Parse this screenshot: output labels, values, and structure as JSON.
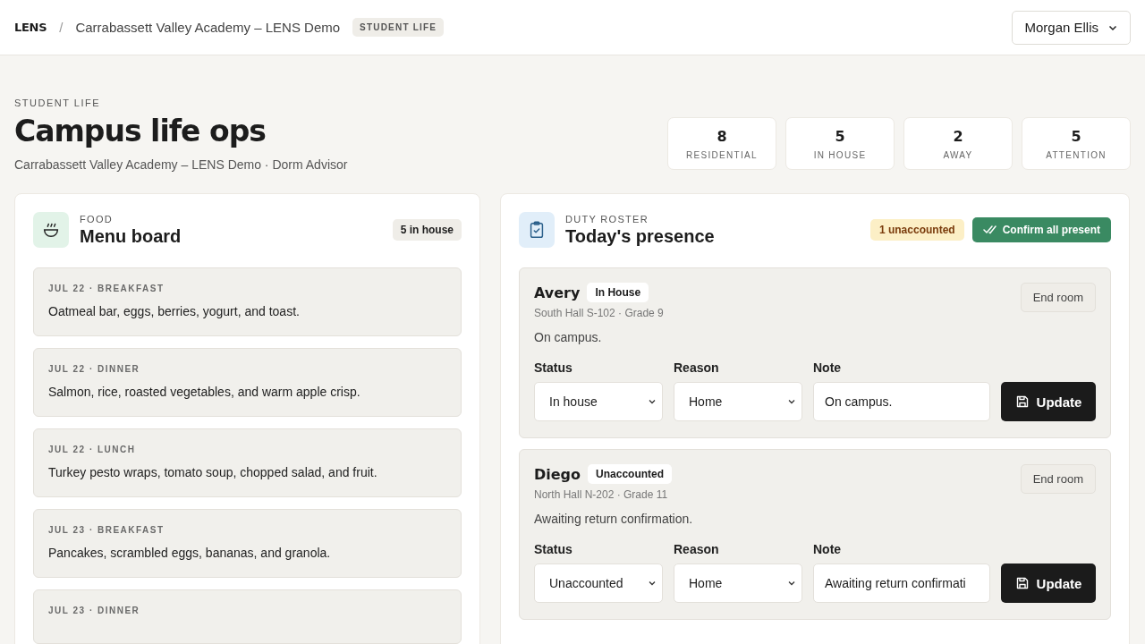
{
  "topbar": {
    "logo": "LENS",
    "separator": "/",
    "school": "Carrabassett Valley Academy – LENS Demo",
    "tag": "STUDENT LIFE",
    "user": "Morgan Ellis"
  },
  "page": {
    "eyebrow": "STUDENT LIFE",
    "title": "Campus life ops",
    "subtitle": "Carrabassett Valley Academy – LENS Demo · Dorm Advisor"
  },
  "stats": [
    {
      "value": "8",
      "label": "RESIDENTIAL"
    },
    {
      "value": "5",
      "label": "IN HOUSE"
    },
    {
      "value": "2",
      "label": "AWAY"
    },
    {
      "value": "5",
      "label": "ATTENTION"
    }
  ],
  "menu_board": {
    "eyebrow": "FOOD",
    "title": "Menu board",
    "badge": "5 in house",
    "items": [
      {
        "label": "JUL 22 · BREAKFAST",
        "text": "Oatmeal bar, eggs, berries, yogurt, and toast."
      },
      {
        "label": "JUL 22 · DINNER",
        "text": "Salmon, rice, roasted vegetables, and warm apple crisp."
      },
      {
        "label": "JUL 22 · LUNCH",
        "text": "Turkey pesto wraps, tomato soup, chopped salad, and fruit."
      },
      {
        "label": "JUL 23 · BREAKFAST",
        "text": "Pancakes, scrambled eggs, bananas, and granola."
      },
      {
        "label": "JUL 23 · DINNER"
      }
    ]
  },
  "roster": {
    "eyebrow": "DUTY ROSTER",
    "title": "Today's presence",
    "badge": "1 unaccounted",
    "confirm_button": "Confirm all present",
    "students": [
      {
        "name": "Avery",
        "status_badge": "In House",
        "room": "South Hall S-102 · Grade 9",
        "note_text": "On campus.",
        "end_button": "End room",
        "status_label": "Status",
        "status": "In house",
        "reason_label": "Reason",
        "reason": "Home",
        "note_label": "Note",
        "note": "On campus.",
        "update_button": "Update"
      },
      {
        "name": "Diego",
        "status_badge": "Unaccounted",
        "room": "North Hall N-202 · Grade 11",
        "note_text": "Awaiting return confirmation.",
        "end_button": "End room",
        "status_label": "Status",
        "status": "Unaccounted",
        "reason_label": "Reason",
        "reason": "Home",
        "note_label": "Note",
        "note": "Awaiting return confirmati",
        "update_button": "Update"
      }
    ]
  }
}
